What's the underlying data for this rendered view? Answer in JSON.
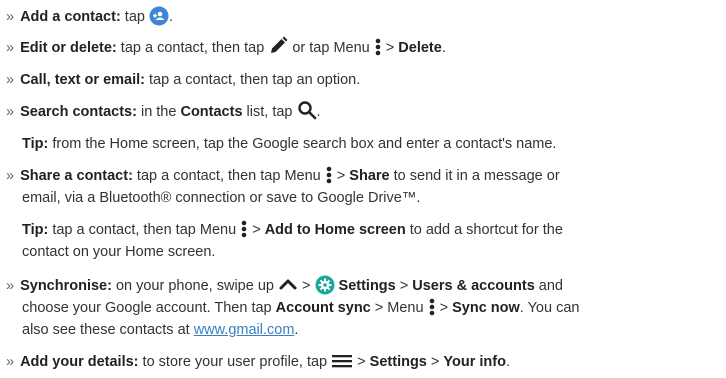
{
  "bullet": "»",
  "colors": {
    "accent_blue": "#3d86d6",
    "settings_teal": "#1da99a",
    "text": "#333333"
  },
  "icons": {
    "add_contact": "add-contact-icon",
    "edit": "pencil-icon",
    "menu": "vertical-dots-menu-icon",
    "search": "search-icon",
    "up": "chevron-up-icon",
    "settings": "settings-gear-icon",
    "hamburger": "hamburger-menu-icon"
  },
  "l1": {
    "bold": "Add a contact:",
    "text": " tap ",
    "after": "."
  },
  "l2": {
    "bold": "Edit or delete:",
    "text1": " tap a contact, then tap ",
    "text2": " or tap Menu ",
    "sep": " > ",
    "bold2": "Delete",
    "end": "."
  },
  "l3": {
    "bold": "Call, text or email:",
    "text": " tap a contact, then tap an option."
  },
  "l4": {
    "bold": "Search contacts:",
    "text1": " in the ",
    "bold2": "Contacts",
    "text2": " list, tap ",
    "end": "."
  },
  "tip1": {
    "bold": "Tip:",
    "text": " from the Home screen, tap the Google search box and enter a contact's name."
  },
  "l5": {
    "bold": "Share a contact:",
    "text1": " tap a contact, then tap Menu ",
    "sep": " > ",
    "bold2": "Share",
    "text2": " to send it in a message or",
    "cont": "email, via a Bluetooth® connection or save to Google Drive™."
  },
  "tip2": {
    "bold": "Tip:",
    "text1": " tap a contact, then tap Menu ",
    "sep": " > ",
    "bold2": "Add to Home screen",
    "text2": " to add a shortcut for the",
    "cont": "contact on your Home screen."
  },
  "l6": {
    "bold": "Synchronise:",
    "text1": " on your phone, swipe up ",
    "sep1": " > ",
    "bold2": "Settings",
    "sep2": " > ",
    "bold3": "Users & accounts",
    "text2": " and",
    "c1_text1": "choose your Google account. Then tap ",
    "c1_bold1": "Account sync",
    "c1_text2": " > Menu ",
    "c1_sep": " > ",
    "c1_bold2": "Sync now",
    "c1_text3": ". You can",
    "c2_text1": "also see these contacts at ",
    "c2_link": "www.gmail.com",
    "c2_end": "."
  },
  "l7": {
    "bold": "Add your details:",
    "text1": " to store your user profile, tap ",
    "sep1": " > ",
    "bold2": "Settings",
    "sep2": " > ",
    "bold3": "Your info",
    "end": "."
  }
}
